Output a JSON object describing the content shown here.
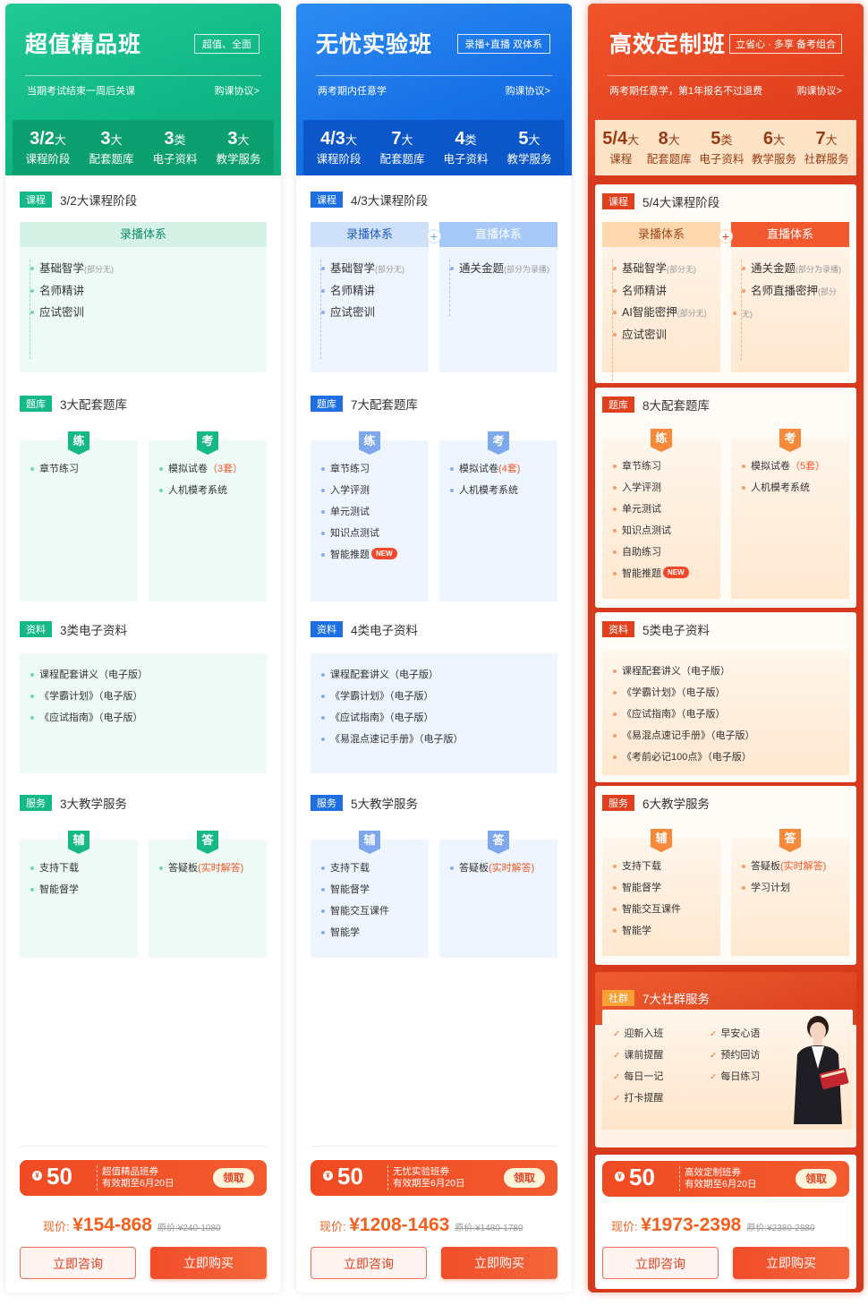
{
  "plans": [
    {
      "title": "超值精品班",
      "tag": "超值、全面",
      "note": "当期考试结束一周后关课",
      "protocol": "购课协议>",
      "stats": [
        {
          "num": "3/2",
          "unit": "大",
          "label": "课程阶段"
        },
        {
          "num": "3",
          "unit": "大",
          "label": "配套题库"
        },
        {
          "num": "3",
          "unit": "类",
          "label": "电子资料"
        },
        {
          "num": "3",
          "unit": "大",
          "label": "教学服务"
        }
      ],
      "course": {
        "badge": "课程",
        "title": "3/2大课程阶段",
        "rec_head": "录播体系",
        "rec": [
          "基础智学",
          "名师精讲",
          "应试密训"
        ],
        "rec_small": "(部分无)"
      },
      "bank": {
        "badge": "题库",
        "title": "3大配套题库",
        "lian": "练",
        "kao": "考",
        "lian_items": [
          "章节练习"
        ],
        "kao_items": [
          "模拟试卷",
          "人机模考系统"
        ],
        "kao_red": "（3套）"
      },
      "material": {
        "badge": "资料",
        "title": "3类电子资料",
        "items": [
          "课程配套讲义（电子版）",
          "《学霸计划》（电子版）",
          "《应试指南》（电子版）"
        ]
      },
      "service": {
        "badge": "服务",
        "title": "3大教学服务",
        "fu": "辅",
        "da": "答",
        "fu_items": [
          "支持下载",
          "智能督学"
        ],
        "da_items": [
          "答疑板"
        ],
        "da_red": "(实时解答)"
      },
      "coupon": {
        "amount": "50",
        "name": "超值精品班券",
        "date": "有效期至6月20日",
        "get": "领取"
      },
      "price": {
        "label": "现价: ",
        "value": "¥154-868",
        "orig": "原价:¥240-1080"
      },
      "consult": "立即咨询",
      "buy": "立即购买"
    },
    {
      "title": "无忧实验班",
      "tag": "录播+直播 双体系",
      "note": "两考期内任意学",
      "protocol": "购课协议>",
      "stats": [
        {
          "num": "4/3",
          "unit": "大",
          "label": "课程阶段"
        },
        {
          "num": "7",
          "unit": "大",
          "label": "配套题库"
        },
        {
          "num": "4",
          "unit": "类",
          "label": "电子资料"
        },
        {
          "num": "5",
          "unit": "大",
          "label": "教学服务"
        }
      ],
      "course": {
        "badge": "课程",
        "title": "4/3大课程阶段",
        "rec_head": "录播体系",
        "live_head": "直播体系",
        "rec": [
          "基础智学",
          "名师精讲",
          "应试密训"
        ],
        "rec_small": "(部分无)",
        "live": [
          "通关金题"
        ],
        "live_small": "(部分为录播)"
      },
      "bank": {
        "badge": "题库",
        "title": "7大配套题库",
        "lian": "练",
        "kao": "考",
        "lian_items": [
          "章节练习",
          "入学评测",
          "单元测试",
          "知识点测试",
          "智能推题"
        ],
        "kao_items": [
          "模拟试卷",
          "人机模考系统"
        ],
        "kao_red": "(4套)",
        "new": "NEW"
      },
      "material": {
        "badge": "资料",
        "title": "4类电子资料",
        "items": [
          "课程配套讲义（电子版）",
          "《学霸计划》（电子版）",
          "《应试指南》（电子版）",
          "《易混点速记手册》（电子版）"
        ]
      },
      "service": {
        "badge": "服务",
        "title": "5大教学服务",
        "fu": "辅",
        "da": "答",
        "fu_items": [
          "支持下载",
          "智能督学",
          "智能交互课件",
          "智能学"
        ],
        "da_items": [
          "答疑板"
        ],
        "da_red": "(实时解答)"
      },
      "coupon": {
        "amount": "50",
        "name": "无忧实验班券",
        "date": "有效期至6月20日",
        "get": "领取"
      },
      "price": {
        "label": "现价: ",
        "value": "¥1208-1463",
        "orig": "原价:¥1480-1780"
      },
      "consult": "立即咨询",
      "buy": "立即购买"
    },
    {
      "title": "高效定制班",
      "tag": "立省心 · 多享 备考组合",
      "note": "两考期任意学，第1年报名不过退费",
      "protocol": "购课协议>",
      "stats": [
        {
          "num": "5/4",
          "unit": "大",
          "label": "课程"
        },
        {
          "num": "8",
          "unit": "大",
          "label": "配套题库"
        },
        {
          "num": "5",
          "unit": "类",
          "label": "电子资料"
        },
        {
          "num": "6",
          "unit": "大",
          "label": "教学服务"
        },
        {
          "num": "7",
          "unit": "大",
          "label": "社群服务"
        }
      ],
      "course": {
        "badge": "课程",
        "title": "5/4大课程阶段",
        "rec_head": "录播体系",
        "live_head": "直播体系",
        "rec": [
          "基础智学",
          "名师精讲",
          "AI智能密押",
          "应试密训"
        ],
        "rec_small": "(部分无)",
        "live": [
          "通关金题",
          "名师直播密押"
        ],
        "live_small": "(部分为录播)",
        "live_small2": "(部分",
        "live_small3": "无)"
      },
      "bank": {
        "badge": "题库",
        "title": "8大配套题库",
        "lian": "练",
        "kao": "考",
        "lian_items": [
          "章节练习",
          "入学评测",
          "单元测试",
          "知识点测试",
          "自助练习",
          "智能推题"
        ],
        "kao_items": [
          "模拟试卷",
          "人机模考系统"
        ],
        "kao_red": "（5套）",
        "new": "NEW"
      },
      "material": {
        "badge": "资料",
        "title": "5类电子资料",
        "items": [
          "课程配套讲义（电子版）",
          "《学霸计划》（电子版）",
          "《应试指南》（电子版）",
          "《易混点速记手册》（电子版）",
          "《考前必记100点》（电子版）"
        ]
      },
      "service": {
        "badge": "服务",
        "title": "6大教学服务",
        "fu": "辅",
        "da": "答",
        "fu_items": [
          "支持下载",
          "智能督学",
          "智能交互课件",
          "智能学"
        ],
        "da_items": [
          "答疑板",
          "学习计划"
        ],
        "da_red": "(实时解答)"
      },
      "community": {
        "badge": "社群",
        "title": "7大社群服务",
        "items": [
          "迎新入班",
          "早安心语",
          "课前提醒",
          "预约回访",
          "每日一记",
          "每日练习",
          "打卡提醒"
        ]
      },
      "coupon": {
        "amount": "50",
        "name": "高效定制班券",
        "date": "有效期至6月20日",
        "get": "领取"
      },
      "price": {
        "label": "现价: ",
        "value": "¥1973-2398",
        "orig": "原价:¥2380-2880"
      },
      "consult": "立即咨询",
      "buy": "立即购买"
    }
  ]
}
